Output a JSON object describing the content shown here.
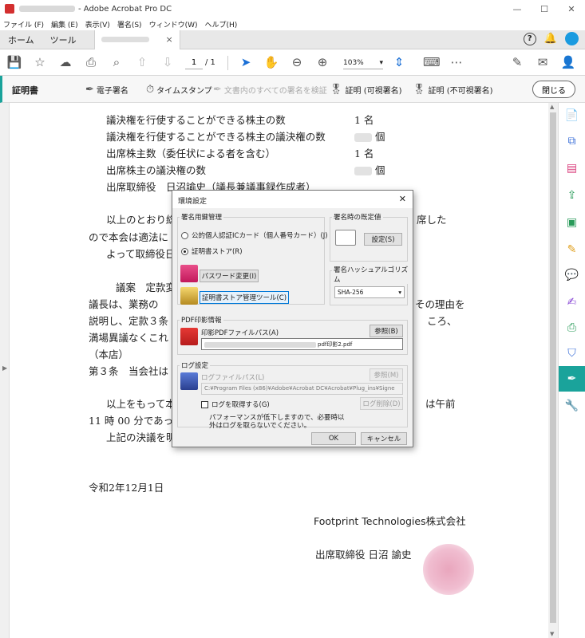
{
  "window": {
    "title": "- Adobe Acrobat Pro DC",
    "controls": [
      "—",
      "☐",
      "✕"
    ]
  },
  "menu": [
    "ファイル (F)",
    "編集 (E)",
    "表示(V)",
    "署名(S)",
    "ウィンドウ(W)",
    "ヘルプ(H)"
  ],
  "tabs": {
    "home": "ホーム",
    "tools": "ツール",
    "close": "×"
  },
  "toolbar": {
    "page_current": "1",
    "page_total": "/ 1",
    "zoom": "103%"
  },
  "certbar": {
    "title": "証明書",
    "digital_sign": "電子署名",
    "timestamp": "タイムスタンプ",
    "verify_all": "文書内のすべての署名を検証",
    "visible_cert": "証明 (可視署名)",
    "invisible_cert": "証明 (不可視署名)",
    "close": "閉じる"
  },
  "document": {
    "lines": [
      "議決権を行使することができる株主の数",
      "議決権を行使することができる株主の議決権の数",
      "出席株主数（委任状による者を含む）",
      "出席株主の議決権の数",
      "出席取締役　日沼諭史（議長兼議事録作成者）",
      "以上のとおり総",
      "ので本会は適法に",
      "よって取締役日",
      "議案　定款変",
      "議長は、業務の",
      "説明し、定款３条",
      "満場異議なくこれ",
      "（本店）",
      "第３条　当会社は",
      "以上をもって本",
      "11 時 00 分であっ",
      "上記の決議を明",
      "令和2年12月1日",
      "Footprint Technologies株式会社",
      "出席取締役 日沼 諭史"
    ],
    "right_fragments": [
      "席した",
      "その理由を",
      "ころ、",
      "は午前"
    ],
    "values": [
      "1 名",
      "個",
      "1 名",
      "個"
    ]
  },
  "dialog": {
    "title": "環境設定",
    "close": "✕",
    "group_cert": "署名用鍵管理",
    "radio_mynumber": "公的個人認証ICカード（個人番号カード）(J)",
    "radio_store": "証明書ストア(R)",
    "btn_password": "パスワード変更(I)",
    "btn_store_tool": "証明書ストア管理ツール(C)",
    "group_default": "署名時の既定値",
    "btn_setting": "設定(S)",
    "group_hash": "署名ハッシュアルゴリズム",
    "hash_value": "SHA-256",
    "group_pdf": "PDF印影情報",
    "pdf_path_label": "印影PDFファイルパス(A)",
    "btn_browse_a": "参照(B)",
    "pdf_path_value": "pdf印影2.pdf",
    "group_log": "ログ設定",
    "log_path_label": "ログファイルパス(L)",
    "btn_browse_m": "参照(M)",
    "log_path_value": "C:¥Program Files (x86)¥Adobe¥Acrobat DC¥Acrobat¥Plug_ins¥Signe",
    "chk_log": "ログを取得する(G)",
    "btn_log_delete": "ログ削除(D)",
    "note1": "パフォーマンスが低下しますので、必要時以",
    "note2": "外はログを取らないでください。",
    "ok": "OK",
    "cancel": "キャンセル"
  }
}
